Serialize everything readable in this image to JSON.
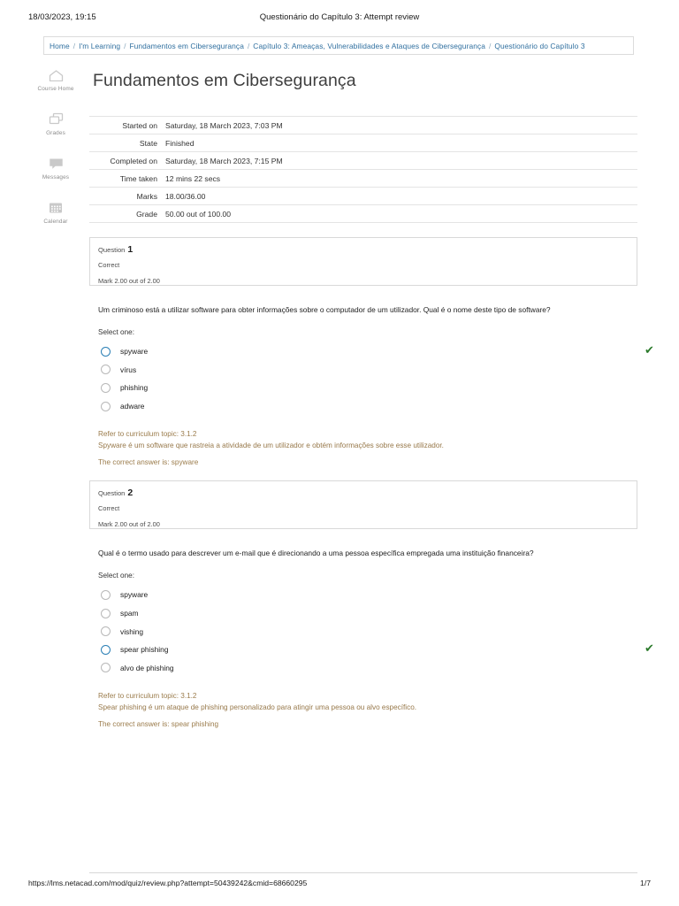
{
  "print_header": {
    "datetime": "18/03/2023, 19:15",
    "doc_title": "Questionário do Capítulo 3: Attempt review"
  },
  "breadcrumb": {
    "separator": "/",
    "items": [
      {
        "label": "Home"
      },
      {
        "label": "I'm Learning"
      },
      {
        "label": "Fundamentos em Cibersegurança"
      },
      {
        "label": "Capítulo 3: Ameaças, Vulnerabilidades e Ataques de Cibersegurança"
      },
      {
        "label": "Questionário do Capítulo 3"
      }
    ]
  },
  "sidebar": {
    "items": [
      {
        "icon": "home-icon",
        "label": "Course Home"
      },
      {
        "icon": "cards-icon",
        "label": "Grades"
      },
      {
        "icon": "message-bubble-icon",
        "label": "Messages"
      },
      {
        "icon": "calendar-icon",
        "label": "Calendar"
      }
    ]
  },
  "page": {
    "title": "Fundamentos em Cibersegurança"
  },
  "summary": {
    "rows": [
      {
        "key": "Started on",
        "value": "Saturday, 18 March 2023, 7:03 PM"
      },
      {
        "key": "State",
        "value": "Finished"
      },
      {
        "key": "Completed on",
        "value": "Saturday, 18 March 2023, 7:15 PM"
      },
      {
        "key": "Time taken",
        "value": "12 mins 22 secs"
      },
      {
        "key": "Marks",
        "value": "18.00/36.00"
      },
      {
        "key": "Grade",
        "value": "50.00 out of 100.00"
      }
    ]
  },
  "questions": [
    {
      "label": "Question",
      "number": "1",
      "state": "Correct",
      "mark": "Mark 2.00 out of 2.00",
      "text": "Um criminoso está a utilizar software para obter informações sobre o computador de um utilizador. Qual é o nome deste tipo de software?",
      "select_label": "Select one:",
      "options": [
        {
          "label": "spyware",
          "selected": true,
          "correct_tick": true
        },
        {
          "label": "vírus",
          "selected": false,
          "correct_tick": false
        },
        {
          "label": "phishing",
          "selected": false,
          "correct_tick": false
        },
        {
          "label": "adware",
          "selected": false,
          "correct_tick": false
        }
      ],
      "feedback_topic": "Refer to curriculum topic: 3.1.2",
      "feedback_text": "Spyware é um software que rastreia a atividade de um utilizador e obtém informações sobre esse utilizador.",
      "correct_answer": "The correct answer is: spyware"
    },
    {
      "label": "Question",
      "number": "2",
      "state": "Correct",
      "mark": "Mark 2.00 out of 2.00",
      "text": "Qual é o termo usado para descrever um e-mail que é direcionando a uma pessoa específica empregada uma instituição financeira?",
      "select_label": "Select one:",
      "options": [
        {
          "label": "spyware",
          "selected": false,
          "correct_tick": false
        },
        {
          "label": "spam",
          "selected": false,
          "correct_tick": false
        },
        {
          "label": "vishing",
          "selected": false,
          "correct_tick": false
        },
        {
          "label": "spear phishing",
          "selected": true,
          "correct_tick": true
        },
        {
          "label": "alvo de phishing",
          "selected": false,
          "correct_tick": false
        }
      ],
      "feedback_topic": "Refer to curriculum topic: 3.1.2",
      "feedback_text": "Spear phishing é um ataque de phishing personalizado para atingir uma pessoa ou alvo específico.",
      "correct_answer": "The correct answer is: spear phishing"
    }
  ],
  "footer": {
    "url": "https://lms.netacad.com/mod/quiz/review.php?attempt=50439242&cmid=68660295",
    "page_number": "1/7"
  },
  "icons": {
    "check": "✔"
  },
  "colors": {
    "link": "#2f6f9f",
    "feedback": "#9b7c4c",
    "selected_radio": "#2a7fb5",
    "tick_green": "#2b7a2b"
  }
}
